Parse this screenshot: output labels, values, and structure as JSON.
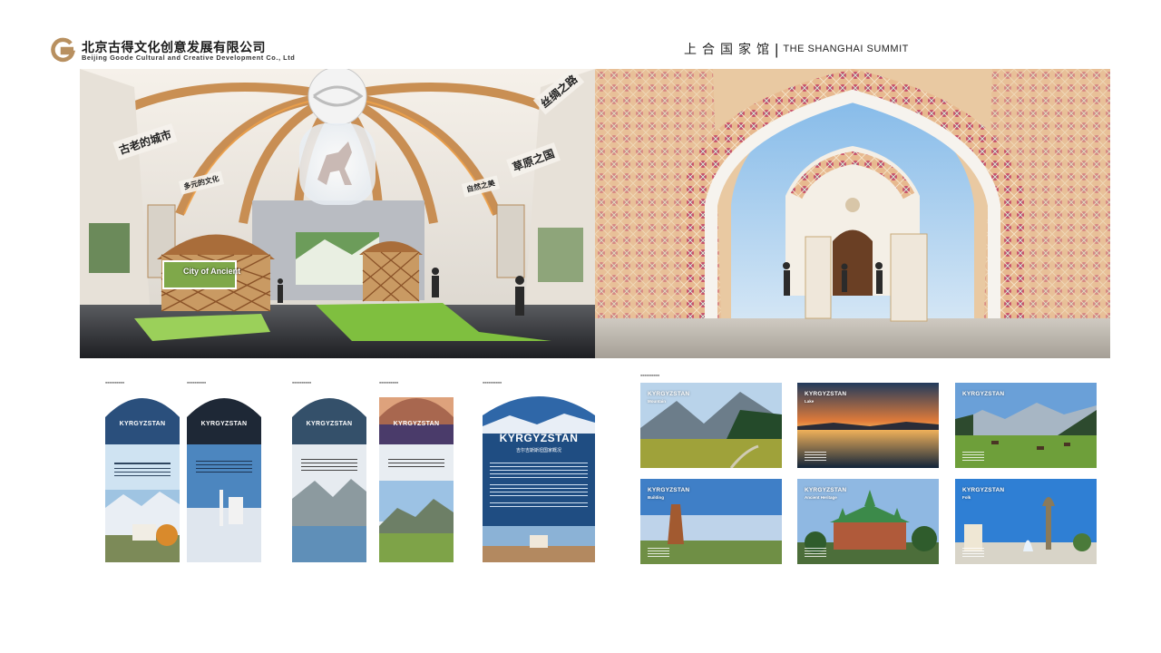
{
  "header": {
    "company_cn": "北京古得文化创意发展有限公司",
    "company_en": "Beijing Goode Cultural and Creative Development Co., Ltd",
    "summit_cn": "上合国家馆",
    "summit_sep": "|",
    "summit_en": "THE SHANGHAI SUMMIT"
  },
  "render_left": {
    "signs": [
      "古老的城市",
      "丝绸之路",
      "草原之国",
      "多元的文化",
      "自然之美"
    ],
    "screen_text": "City of Ancient"
  },
  "banners": [
    {
      "title": "KYRGYZSTAN"
    },
    {
      "title": "KYRGYZSTAN"
    },
    {
      "title": "KYRGYZSTAN"
    },
    {
      "title": "KYRGYZSTAN"
    },
    {
      "title": "KYRGYZSTAN",
      "subtitle": "吉尔吉斯斯坦国家概况"
    }
  ],
  "cards": [
    {
      "title": "KYRGYZSTAN",
      "subtitle": "Mountain"
    },
    {
      "title": "KYRGYZSTAN",
      "subtitle": "Lake"
    },
    {
      "title": "KYRGYZSTAN",
      "subtitle": ""
    },
    {
      "title": "KYRGYZSTAN",
      "subtitle": "Building"
    },
    {
      "title": "KYRGYZSTAN",
      "subtitle": "Ancient Heritage"
    },
    {
      "title": "KYRGYZSTAN",
      "subtitle": "Folk"
    }
  ],
  "colors": {
    "logo_gold": "#b89060",
    "text_dark": "#1a1a1a",
    "sky_blue": "#2f6fb0",
    "arch_white": "#f4f2ee",
    "wood": "#b07840"
  }
}
